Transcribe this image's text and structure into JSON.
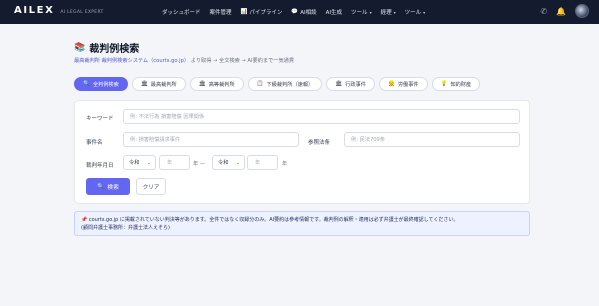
{
  "header": {
    "brand": "AILEX",
    "brand_sub": "AI LEGAL EXPERT",
    "nav": [
      {
        "label": "ダッシュボード",
        "icon": "",
        "caret": false
      },
      {
        "label": "案件管理",
        "icon": "",
        "caret": false
      },
      {
        "label": "パイプライン",
        "icon": "📊",
        "caret": false
      },
      {
        "label": "AI相談",
        "icon": "💬",
        "caret": false
      },
      {
        "label": "AI生成",
        "icon": "",
        "caret": false
      },
      {
        "label": "ツール",
        "icon": "",
        "caret": true
      },
      {
        "label": "経理",
        "icon": "",
        "caret": true
      },
      {
        "label": "ツール",
        "icon": "",
        "caret": true
      }
    ]
  },
  "page": {
    "title_icon": "📚",
    "title": "裁判例検索",
    "subtitle_link": "最高裁判所 裁判例検索システム（courts.go.jp）",
    "subtitle_rest": "より取得 → 全文検索 → AI要約まで一気通貫"
  },
  "tabs": [
    {
      "label": "全判例検索",
      "icon": "🔍",
      "active": true
    },
    {
      "label": "最高裁判所",
      "icon": "🏛",
      "active": false
    },
    {
      "label": "高等裁判所",
      "icon": "🏛",
      "active": false
    },
    {
      "label": "下級裁判所（速報）",
      "icon": "📋",
      "active": false
    },
    {
      "label": "行政事件",
      "icon": "🏛",
      "active": false
    },
    {
      "label": "労働事件",
      "icon": "👷",
      "active": false
    },
    {
      "label": "知的財産",
      "icon": "💡",
      "active": false
    }
  ],
  "form": {
    "keyword_label": "キーワード",
    "keyword_placeholder": "例: 不法行為 損害賠償 因果関係",
    "case_name_label": "事件名",
    "case_name_placeholder": "例: 損害賠償請求事件",
    "statute_label": "参照法条",
    "statute_placeholder": "例: 民法709条",
    "date_label": "裁判年月日",
    "era_from": "令和",
    "year_from_placeholder": "年",
    "year_from_suffix": "年 —",
    "era_to": "令和",
    "year_to_placeholder": "年",
    "year_to_suffix": "年",
    "search_button": "検索",
    "clear_button": "クリア"
  },
  "notice": {
    "line1": "courts.go.jp に掲載されていない判決等があります。全件ではなく収録分のみ。AI要約は参考情報です。裁判例の解釈・適用は必ず弁護士が最終確認してください。",
    "line2": "(顧問弁護士事務所：弁護士法人えそら)"
  }
}
